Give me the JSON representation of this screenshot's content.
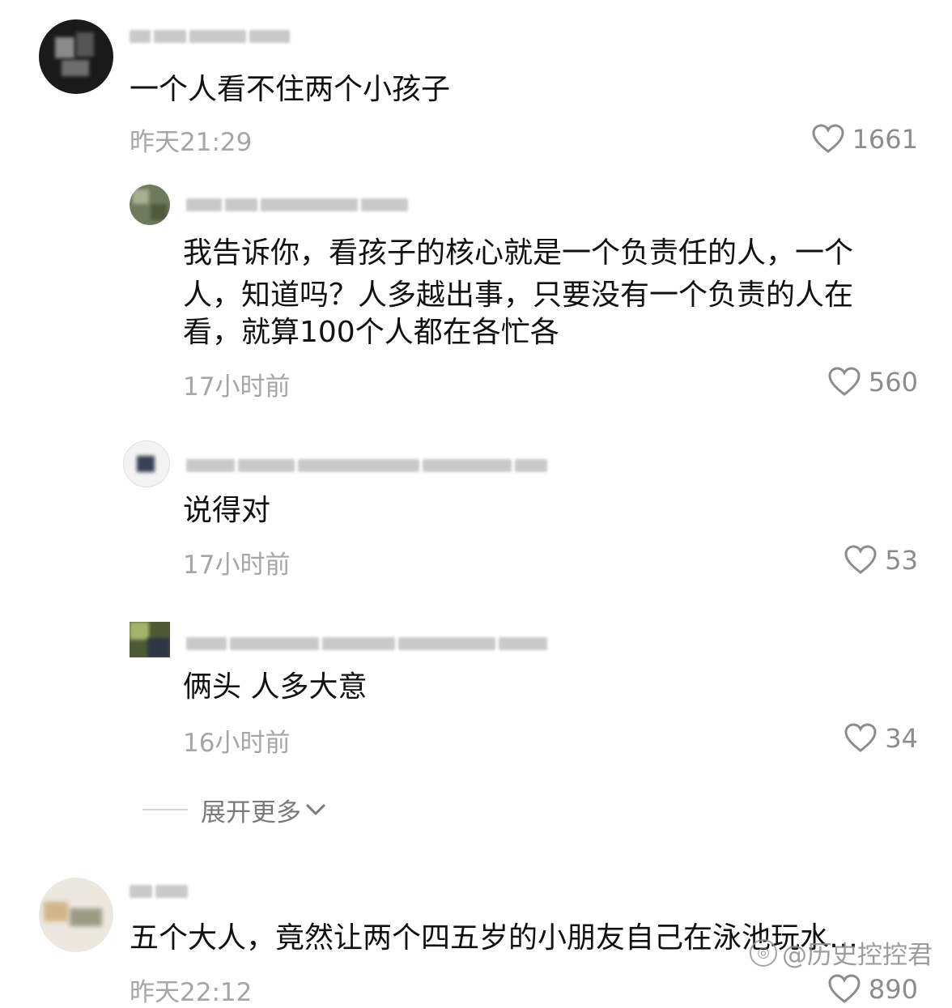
{
  "comments": [
    {
      "text": "一个人看不住两个小孩子",
      "time": "昨天21:29",
      "likes": "1661"
    },
    {
      "text_lines": [
        "我告诉你，看孩子的核心就是一个负责任的人，一个",
        "人，知道吗？人多越出事，只要没有一个负责的人在",
        "看，就算100个人都在各忙各"
      ],
      "time": "17小时前",
      "likes": "560"
    },
    {
      "text": "说得对",
      "time": "17小时前",
      "likes": "53"
    },
    {
      "text": "俩头 人多大意",
      "time": "16小时前",
      "likes": "34"
    },
    {
      "text": "五个大人，竟然让两个四五岁的小朋友自己在泳池玩水…",
      "time": "昨天22:12",
      "likes": "890"
    }
  ],
  "expand_more": "展开更多",
  "watermark": "@历史控控君",
  "icons": {
    "like": "heart-outline-icon",
    "expand": "chevron-down-icon"
  },
  "colors": {
    "text": "#111111",
    "meta": "#a6a6a6",
    "like": "#8c8c8c"
  }
}
